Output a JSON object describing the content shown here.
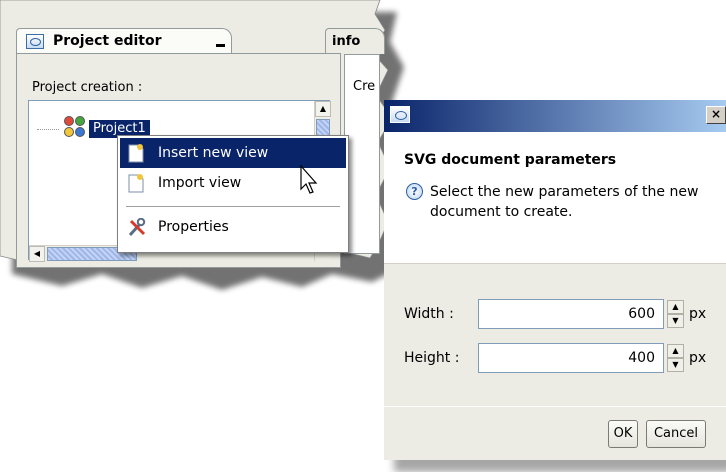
{
  "editor": {
    "tab_title": "Project editor",
    "info_tab_title": "info",
    "info_text": "Cre",
    "section_label": "Project creation :",
    "tree_item_label": "Project1"
  },
  "context_menu": {
    "items": [
      {
        "label": "Insert new view",
        "icon": "new-view-icon",
        "selected": true
      },
      {
        "label": "Import view",
        "icon": "import-view-icon",
        "selected": false
      },
      {
        "label": "Properties",
        "icon": "properties-icon",
        "selected": false
      }
    ]
  },
  "dialog": {
    "heading": "SVG document parameters",
    "description": "Select the new parameters of the new document to create.",
    "close_label": "×",
    "fields": [
      {
        "label": "Width :",
        "value": "600",
        "unit": "px"
      },
      {
        "label": "Height :",
        "value": "400",
        "unit": "px"
      }
    ],
    "ok_label": "OK",
    "cancel_label": "Cancel"
  },
  "colors": {
    "selection": "#0a246a",
    "panel": "#ecebe4",
    "titlebar_start": "#0a246a",
    "titlebar_end": "#a6caf0"
  }
}
